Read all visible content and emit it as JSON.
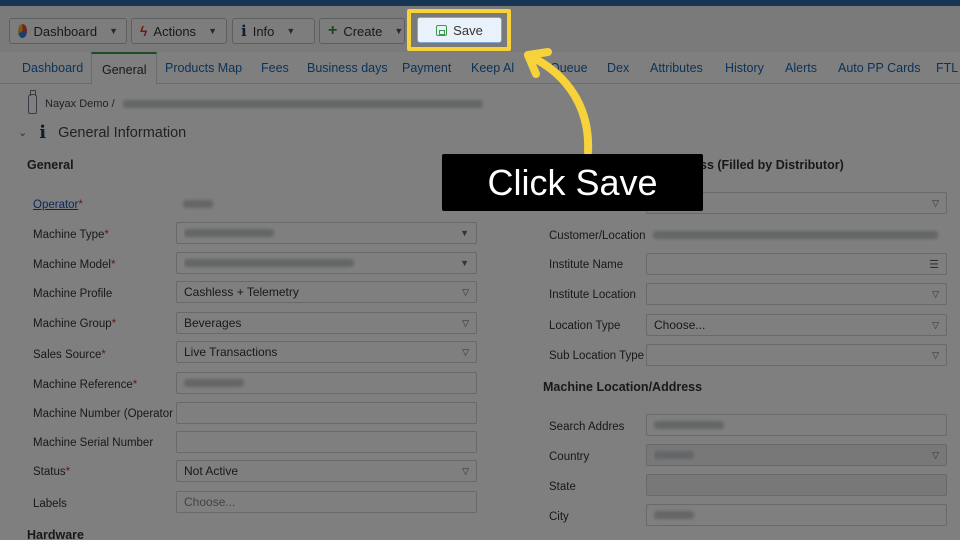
{
  "toolbar": {
    "dashboard": "Dashboard",
    "actions": "Actions",
    "info": "Info",
    "create": "Create",
    "save": "Save"
  },
  "tabs": [
    "Dashboard",
    "General",
    "Products Map",
    "Fees",
    "Business days",
    "Payment",
    "Keep Al",
    "Queue",
    "Dex",
    "Attributes",
    "History",
    "Alerts",
    "Auto PP Cards",
    "FTL"
  ],
  "active_tab": "General",
  "breadcrumb": {
    "root": "Nayax Demo /"
  },
  "section": {
    "title": "General Information"
  },
  "general": {
    "heading": "General",
    "operator": "Operator",
    "machine_type": "Machine Type",
    "machine_model": "Machine Model",
    "machine_profile": "Machine Profile",
    "machine_profile_value": "Cashless + Telemetry",
    "machine_group": "Machine Group",
    "machine_group_value": "Beverages",
    "sales_source": "Sales Source",
    "sales_source_value": "Live Transactions",
    "machine_reference": "Machine Reference",
    "machine_number": "Machine Number (Operator",
    "machine_serial": "Machine Serial Number",
    "status": "Status",
    "status_value": "Not Active",
    "labels": "Labels",
    "labels_placeholder": "Choose...",
    "required_mark": "*"
  },
  "hardware": {
    "heading": "Hardware"
  },
  "address": {
    "heading": "ss (Filled by Distributor)",
    "customer_location": "Customer/Location",
    "institute_name": "Institute Name",
    "institute_location": "Institute Location",
    "location_type": "Location Type",
    "location_type_value": "Choose...",
    "sub_location_type": "Sub Location Type"
  },
  "machine_location": {
    "heading": "Machine Location/Address",
    "search_address": "Search Addres",
    "country": "Country",
    "state": "State",
    "city": "City"
  },
  "callout": {
    "text": "Click Save"
  },
  "colors": {
    "highlight": "#f7d23a",
    "accent_green": "#3a9a4b",
    "link_blue": "#1a66b3"
  }
}
